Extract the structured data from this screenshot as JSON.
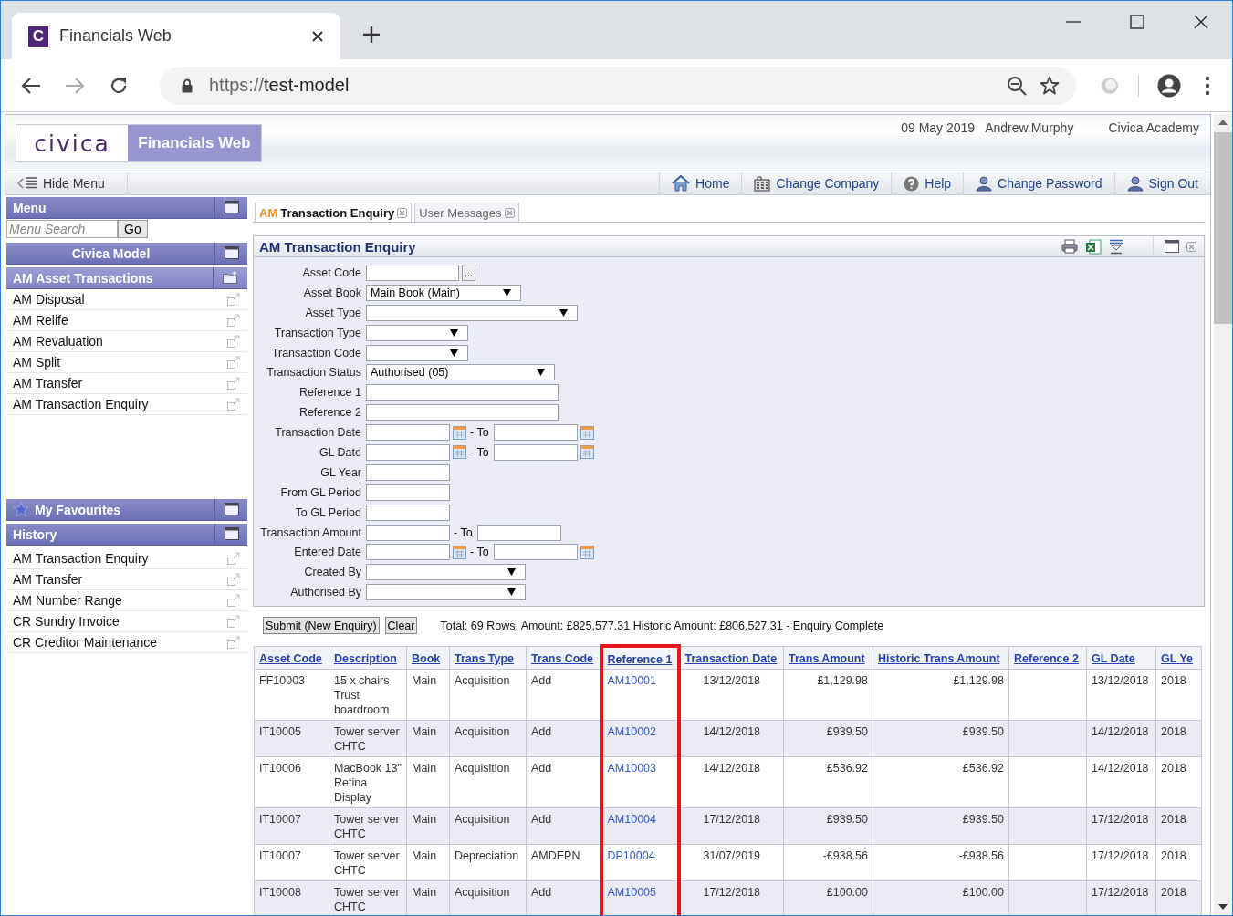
{
  "browser": {
    "tab_title": "Financials Web",
    "favicon_letter": "C",
    "url_scheme": "https://",
    "url_host": "test-model"
  },
  "header": {
    "logo": "civica",
    "app_name": "Financials Web",
    "date": "09 May 2019",
    "user": "Andrew.Murphy",
    "organisation": "Civica Academy"
  },
  "nav": {
    "hide_menu": "Hide Menu",
    "links": [
      {
        "kind": "home",
        "label": "Home"
      },
      {
        "kind": "company",
        "label": "Change Company"
      },
      {
        "kind": "help",
        "label": "Help"
      },
      {
        "kind": "password",
        "label": "Change Password"
      },
      {
        "kind": "signout",
        "label": "Sign Out"
      }
    ]
  },
  "sidebar": {
    "menu_title": "Menu",
    "search_placeholder": "Menu Search",
    "go_label": "Go",
    "model_title": "Civica Model",
    "section_title": "AM Asset Transactions",
    "items": [
      "AM Disposal",
      "AM Relife",
      "AM Revaluation",
      "AM Split",
      "AM Transfer",
      "AM Transaction Enquiry"
    ],
    "favourites_title": "My Favourites",
    "history_title": "History",
    "history_items": [
      "AM Transaction Enquiry",
      "AM Transfer",
      "AM Number Range",
      "CR Sundry Invoice",
      "CR Creditor Maintenance"
    ]
  },
  "tabs": [
    {
      "prefix": "AM",
      "label": "Transaction Enquiry",
      "selected": true
    },
    {
      "label": "User Messages",
      "selected": false
    }
  ],
  "panel": {
    "title": "AM Transaction Enquiry",
    "fields": [
      {
        "label": "Asset Code",
        "kind": "lookup",
        "button_label": "..."
      },
      {
        "label": "Asset Book",
        "kind": "select",
        "value": "Main Book (Main)"
      },
      {
        "label": "Asset Type",
        "kind": "select"
      },
      {
        "label": "Transaction Type",
        "kind": "select"
      },
      {
        "label": "Transaction Code",
        "kind": "select"
      },
      {
        "label": "Transaction Status",
        "kind": "select",
        "value": "Authorised (05)"
      },
      {
        "label": "Reference 1",
        "kind": "text"
      },
      {
        "label": "Reference 2",
        "kind": "text"
      },
      {
        "label": "Transaction Date",
        "kind": "date_range",
        "separator": "- To"
      },
      {
        "label": "GL Date",
        "kind": "date_range",
        "separator": "- To"
      },
      {
        "label": "GL Year",
        "kind": "text"
      },
      {
        "label": "From GL Period",
        "kind": "text"
      },
      {
        "label": "To GL Period",
        "kind": "text"
      },
      {
        "label": "Transaction Amount",
        "kind": "range",
        "separator": "- To"
      },
      {
        "label": "Entered Date",
        "kind": "date_range",
        "separator": "- To"
      },
      {
        "label": "Created By",
        "kind": "select"
      },
      {
        "label": "Authorised By",
        "kind": "select"
      }
    ]
  },
  "actions": {
    "buttons": [
      "Submit (New Enquiry)",
      "Clear"
    ],
    "summary": "Total: 69 Rows, Amount: £825,577.31 Historic Amount: £806,527.31 - Enquiry Complete"
  },
  "table": {
    "columns": [
      {
        "label": "Asset Code",
        "kind": "text",
        "highlighted": false
      },
      {
        "label": "Description",
        "kind": "text",
        "highlighted": false
      },
      {
        "label": "Book",
        "kind": "text",
        "highlighted": false
      },
      {
        "label": "Trans Type",
        "kind": "text",
        "highlighted": false
      },
      {
        "label": "Trans Code",
        "kind": "text",
        "highlighted": false
      },
      {
        "label": "Reference 1",
        "kind": "link",
        "highlighted": true
      },
      {
        "label": "Transaction Date",
        "kind": "date",
        "highlighted": false
      },
      {
        "label": "Trans Amount",
        "kind": "amount",
        "highlighted": false
      },
      {
        "label": "Historic Trans Amount",
        "kind": "amount",
        "highlighted": false
      },
      {
        "label": "Reference 2",
        "kind": "text",
        "highlighted": false
      },
      {
        "label": "GL Date",
        "kind": "text",
        "highlighted": false
      },
      {
        "label": "GL Ye",
        "kind": "text",
        "highlighted": false
      }
    ],
    "rows": [
      [
        "FF10003",
        "15 x chairs Trust boardroom",
        "Main",
        "Acquisition",
        "Add",
        "AM10001",
        "13/12/2018",
        "£1,129.98",
        "£1,129.98",
        "",
        "13/12/2018",
        "2018"
      ],
      [
        "IT10005",
        "Tower server CHTC",
        "Main",
        "Acquisition",
        "Add",
        "AM10002",
        "14/12/2018",
        "£939.50",
        "£939.50",
        "",
        "14/12/2018",
        "2018"
      ],
      [
        "IT10006",
        "MacBook 13\" Retina Display",
        "Main",
        "Acquisition",
        "Add",
        "AM10003",
        "14/12/2018",
        "£536.92",
        "£536.92",
        "",
        "14/12/2018",
        "2018"
      ],
      [
        "IT10007",
        "Tower server CHTC",
        "Main",
        "Acquisition",
        "Add",
        "AM10004",
        "17/12/2018",
        "£939.50",
        "£939.50",
        "",
        "17/12/2018",
        "2018"
      ],
      [
        "IT10007",
        "Tower server CHTC",
        "Main",
        "Depreciation",
        "AMDEPN",
        "DP10004",
        "31/07/2019",
        "-£938.56",
        "-£938.56",
        "",
        "17/12/2018",
        "2018"
      ],
      [
        "IT10008",
        "Tower server CHTC",
        "Main",
        "Acquisition",
        "Add",
        "AM10005",
        "17/12/2018",
        "£100.00",
        "£100.00",
        "",
        "17/12/2018",
        "2018"
      ]
    ]
  }
}
